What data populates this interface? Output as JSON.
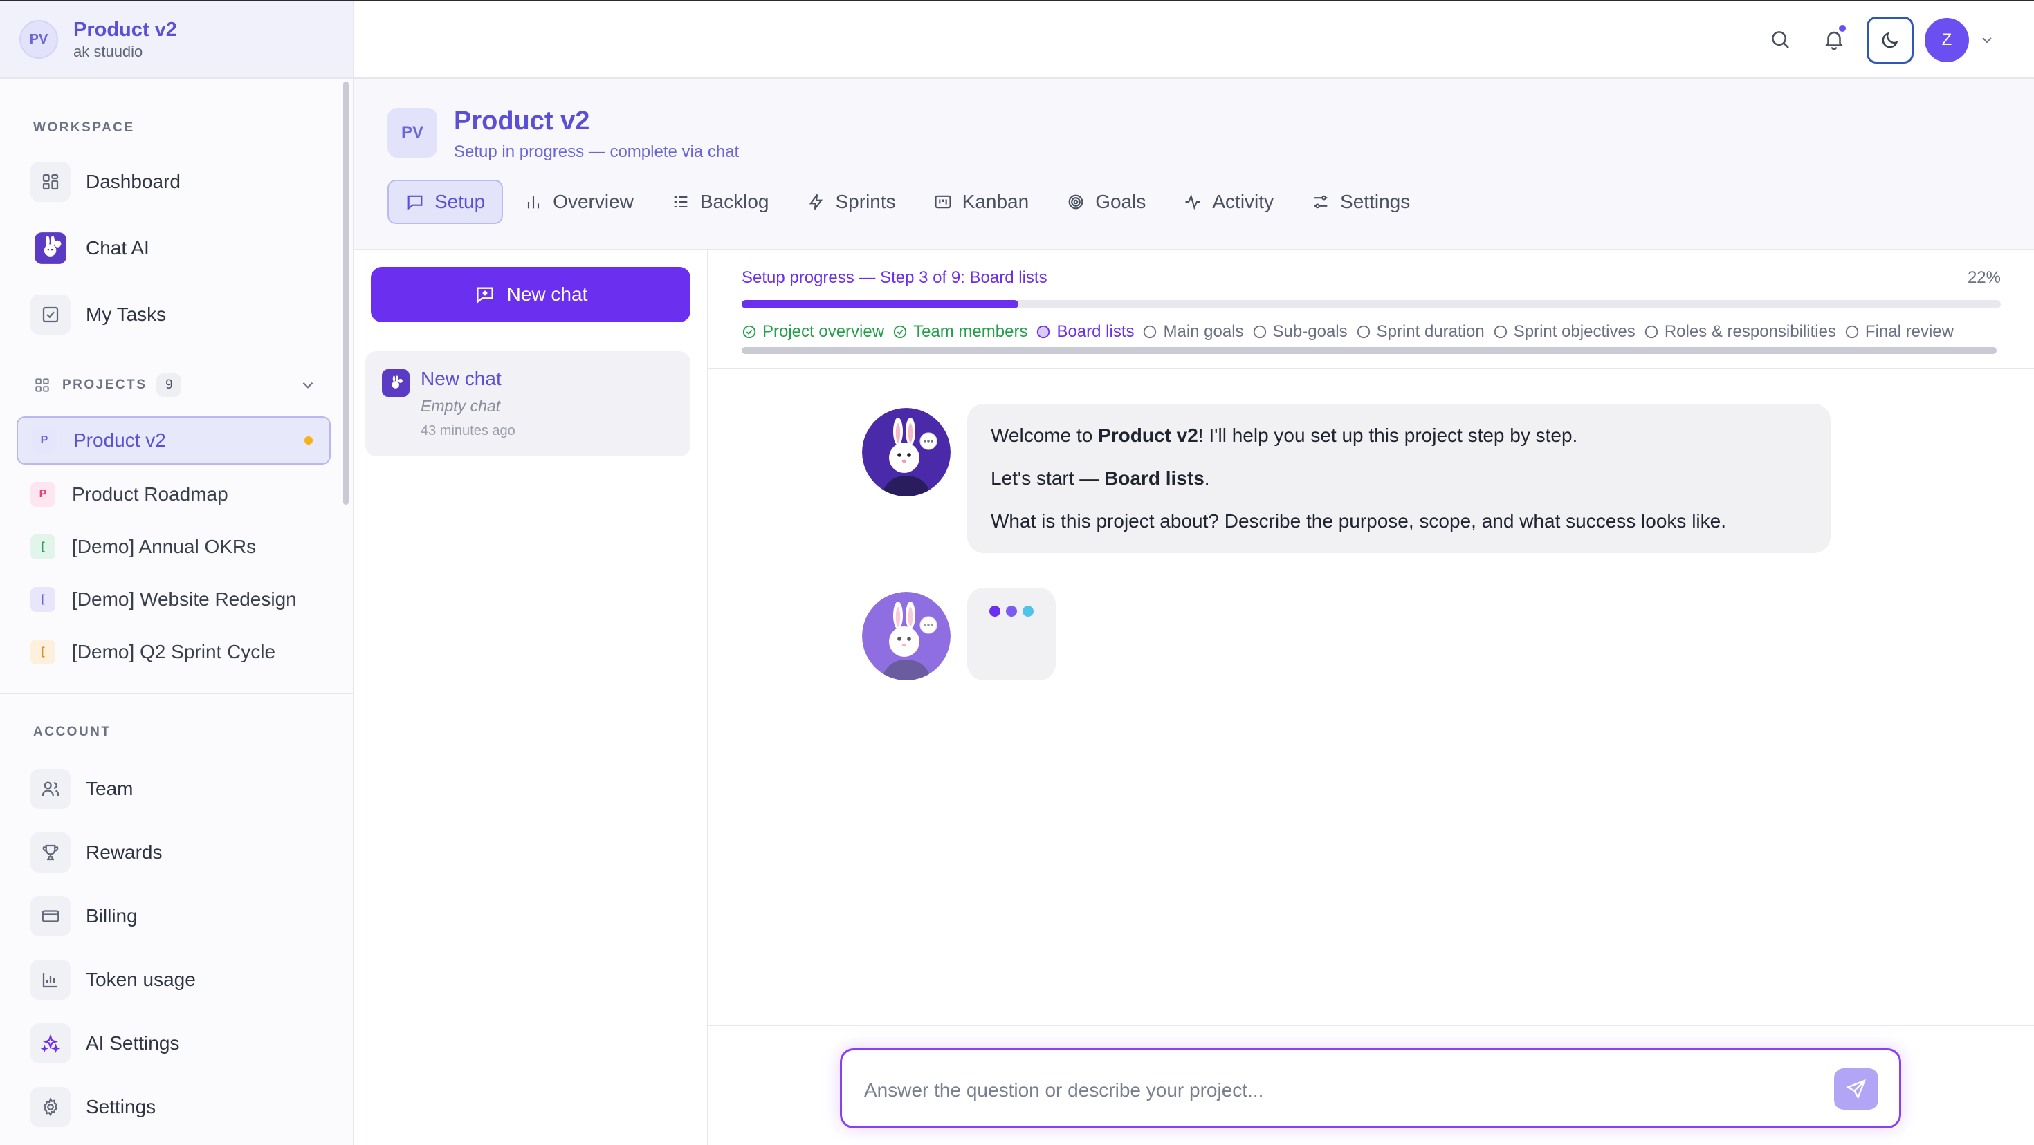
{
  "sidebar": {
    "header": {
      "badge": "PV",
      "title": "Product v2",
      "subtitle": "ak stuudio"
    },
    "workspace_label": "WORKSPACE",
    "workspace_items": [
      {
        "label": "Dashboard",
        "icon": "dashboard-icon"
      },
      {
        "label": "Chat AI",
        "icon": "bunny-logo-icon"
      },
      {
        "label": "My Tasks",
        "icon": "checkbox-icon"
      }
    ],
    "projects_label": "PROJECTS",
    "projects_count": "9",
    "projects": [
      {
        "badge": "P",
        "name": "Product v2",
        "active": true,
        "badge_bg": "#e5e6fb",
        "badge_color": "#6b66d8"
      },
      {
        "badge": "P",
        "name": "Product Roadmap",
        "badge_bg": "#fde6ef",
        "badge_color": "#e0457b"
      },
      {
        "badge": "[",
        "name": "[Demo] Annual OKRs",
        "badge_bg": "#e2f5ea",
        "badge_color": "#2f9d5c"
      },
      {
        "badge": "[",
        "name": "[Demo] Website Redesign",
        "badge_bg": "#e8e6fb",
        "badge_color": "#6b5fe0"
      },
      {
        "badge": "[",
        "name": "[Demo] Q2 Sprint Cycle",
        "badge_bg": "#fdf0dc",
        "badge_color": "#d99222"
      }
    ],
    "account_label": "ACCOUNT",
    "account_items": [
      {
        "label": "Team",
        "icon": "users-icon"
      },
      {
        "label": "Rewards",
        "icon": "trophy-icon"
      },
      {
        "label": "Billing",
        "icon": "credit-card-icon"
      },
      {
        "label": "Token usage",
        "icon": "bar-chart-icon"
      },
      {
        "label": "AI Settings",
        "icon": "sparkles-icon"
      },
      {
        "label": "Settings",
        "icon": "gear-icon"
      }
    ]
  },
  "topbar": {
    "avatar_initial": "Z",
    "accent": "#6b4ff0"
  },
  "project": {
    "badge": "PV",
    "title": "Product v2",
    "subtitle": "Setup in progress — complete via chat",
    "tabs": [
      {
        "label": "Setup",
        "icon": "chat-square-icon",
        "active": true
      },
      {
        "label": "Overview",
        "icon": "bar-chart-icon"
      },
      {
        "label": "Backlog",
        "icon": "list-icon"
      },
      {
        "label": "Sprints",
        "icon": "bolt-icon"
      },
      {
        "label": "Kanban",
        "icon": "kanban-icon"
      },
      {
        "label": "Goals",
        "icon": "target-icon"
      },
      {
        "label": "Activity",
        "icon": "activity-icon"
      },
      {
        "label": "Settings",
        "icon": "sliders-icon"
      }
    ]
  },
  "chat_list": {
    "new_chat_label": "New chat",
    "items": [
      {
        "title": "New chat",
        "preview": "Empty chat",
        "time": "43 minutes ago"
      }
    ]
  },
  "setup": {
    "progress_label": "Setup progress — Step 3 of 9: Board lists",
    "percent_text": "22%",
    "progress_fraction": 0.22,
    "steps": [
      {
        "label": "Project overview",
        "status": "done"
      },
      {
        "label": "Team members",
        "status": "done"
      },
      {
        "label": "Board lists",
        "status": "current"
      },
      {
        "label": "Main goals",
        "status": "todo"
      },
      {
        "label": "Sub-goals",
        "status": "todo"
      },
      {
        "label": "Sprint duration",
        "status": "todo"
      },
      {
        "label": "Sprint objectives",
        "status": "todo"
      },
      {
        "label": "Roles & responsibilities",
        "status": "todo"
      },
      {
        "label": "Final review",
        "status": "todo"
      }
    ]
  },
  "messages": {
    "welcome_pre": "Welcome to ",
    "welcome_bold": "Product v2",
    "welcome_post": "! I'll help you set up this project step by step.",
    "start_pre": "Let's start — ",
    "start_bold": "Board lists",
    "start_post": ".",
    "question": "What is this project about? Describe the purpose, scope, and what success looks like.",
    "typing_colors": [
      "#6b2ff0",
      "#7a5cf0",
      "#4fc3e8"
    ]
  },
  "composer": {
    "placeholder": "Answer the question or describe your project...",
    "value": ""
  }
}
